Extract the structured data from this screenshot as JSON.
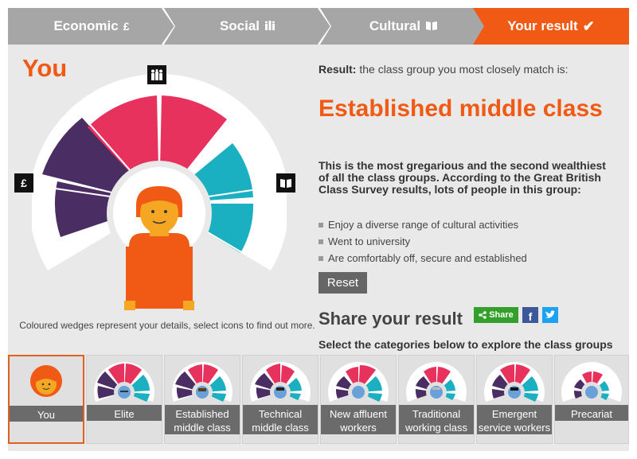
{
  "steps": [
    {
      "label": "Economic",
      "icon_name": "pound-icon",
      "icon_glyph": "£",
      "color": "#a6a6a6"
    },
    {
      "label": "Social",
      "icon_name": "people-icon",
      "icon_glyph": "👥",
      "color": "#a6a6a6"
    },
    {
      "label": "Cultural",
      "icon_name": "book-icon",
      "icon_glyph": "📖",
      "color": "#a6a6a6"
    },
    {
      "label": "Your result",
      "icon_name": "check-icon",
      "icon_glyph": "✔",
      "color": "#f05a14"
    }
  ],
  "left": {
    "title": "You",
    "caption": "Coloured wedges represent your details, select icons to find out more.",
    "icons": {
      "economic": "£",
      "social_name": "people-icon",
      "cultural_name": "book-icon"
    }
  },
  "result": {
    "label": "Result:",
    "intro": "the class group you most closely match is:",
    "class_name": "Established middle class",
    "description": "This is the most gregarious and the second wealthiest of all the class groups. According to the Great British Class Survey results, lots of people in this group:",
    "bullets": [
      "Enjoy a diverse range of cultural activities",
      "Went to university",
      "Are comfortably off, secure and established"
    ],
    "reset_label": "Reset"
  },
  "share": {
    "title": "Share your result",
    "share_label": "Share",
    "facebook_glyph": "f",
    "twitter_glyph": "🐦"
  },
  "select_text": "Select the categories below to explore the class groups",
  "cards": [
    {
      "label": "You"
    },
    {
      "label": "Elite"
    },
    {
      "label": "Established middle class"
    },
    {
      "label": "Technical middle class"
    },
    {
      "label": "New affluent workers"
    },
    {
      "label": "Traditional working class"
    },
    {
      "label": "Emergent service workers"
    },
    {
      "label": "Precariat"
    }
  ],
  "colors": {
    "accent": "#f05a14",
    "economic_wedge": "#4a2d62",
    "social_wedge": "#e8325e",
    "cultural_wedge": "#1ab0c1",
    "inactive_tab": "#a6a6a6"
  }
}
